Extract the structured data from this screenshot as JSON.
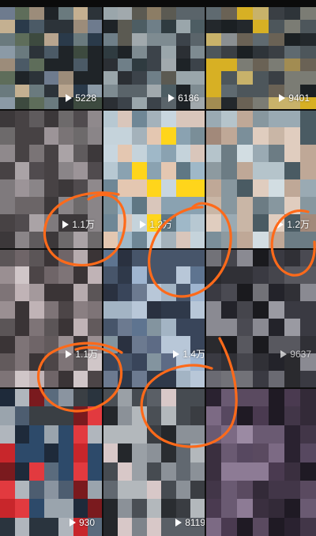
{
  "tiles": [
    {
      "count": "5228"
    },
    {
      "count": "6186"
    },
    {
      "count": "9401"
    },
    {
      "count": "1.1万"
    },
    {
      "count": "1.2万"
    },
    {
      "count": "1.2万"
    },
    {
      "count": "1.1万"
    },
    {
      "count": "1.4万"
    },
    {
      "count": "9637"
    },
    {
      "count": "930"
    },
    {
      "count": "8119"
    },
    {
      "count": ""
    }
  ],
  "colors": {
    "annotation_circle": "#ff6a1a"
  }
}
